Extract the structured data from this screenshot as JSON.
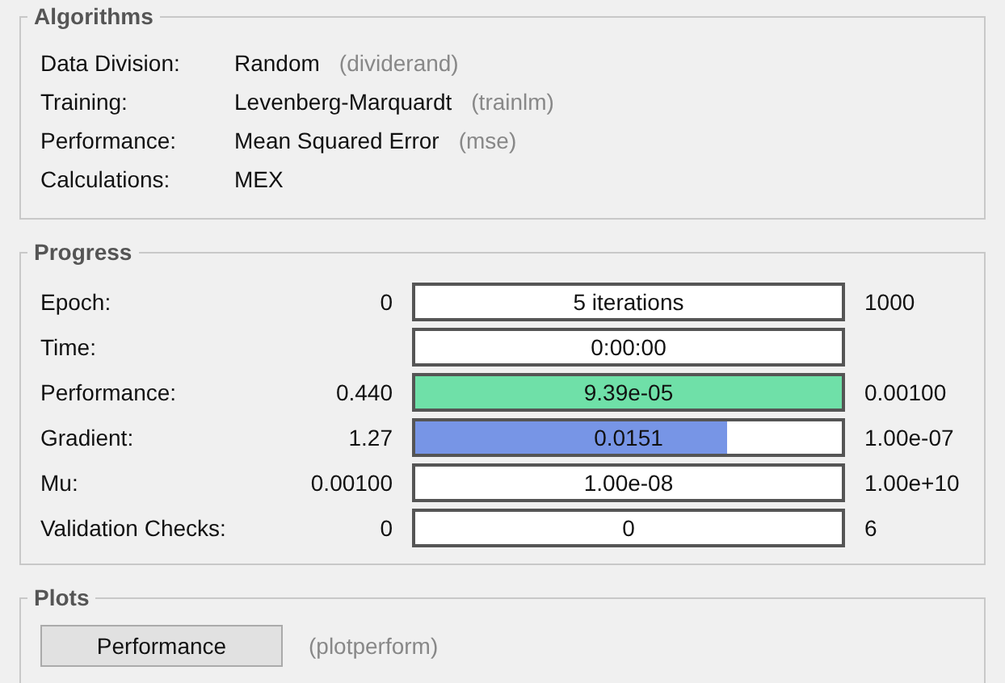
{
  "algorithms": {
    "title": "Algorithms",
    "rows": [
      {
        "label": "Data Division:",
        "value": "Random",
        "function": "(dividerand)"
      },
      {
        "label": "Training:",
        "value": "Levenberg-Marquardt",
        "function": "(trainlm)"
      },
      {
        "label": "Performance:",
        "value": "Mean Squared Error",
        "function": "(mse)"
      },
      {
        "label": "Calculations:",
        "value": "MEX"
      }
    ]
  },
  "progress": {
    "title": "Progress",
    "rows": [
      {
        "label": "Epoch:",
        "start": "0",
        "reading": "5 iterations",
        "end": "1000"
      },
      {
        "label": "Time:",
        "reading": "0:00:00"
      },
      {
        "label": "Performance:",
        "start": "0.440",
        "reading": "9.39e-05",
        "level": 1,
        "color": "#6fe0a8",
        "end": "0.00100"
      },
      {
        "label": "Gradient:",
        "start": "1.27",
        "reading": "0.0151",
        "level": 0.73,
        "color": "#7795e6",
        "end": "1.00e-07"
      },
      {
        "label": "Mu:",
        "start": "0.00100",
        "reading": "1.00e-08",
        "end": "1.00e+10"
      },
      {
        "label": "Validation Checks:",
        "start": "0",
        "reading": "0",
        "end": "6"
      }
    ]
  },
  "plots": {
    "title": "Plots",
    "items": [
      {
        "button": "Performance",
        "function": "(plotperform)"
      }
    ]
  }
}
